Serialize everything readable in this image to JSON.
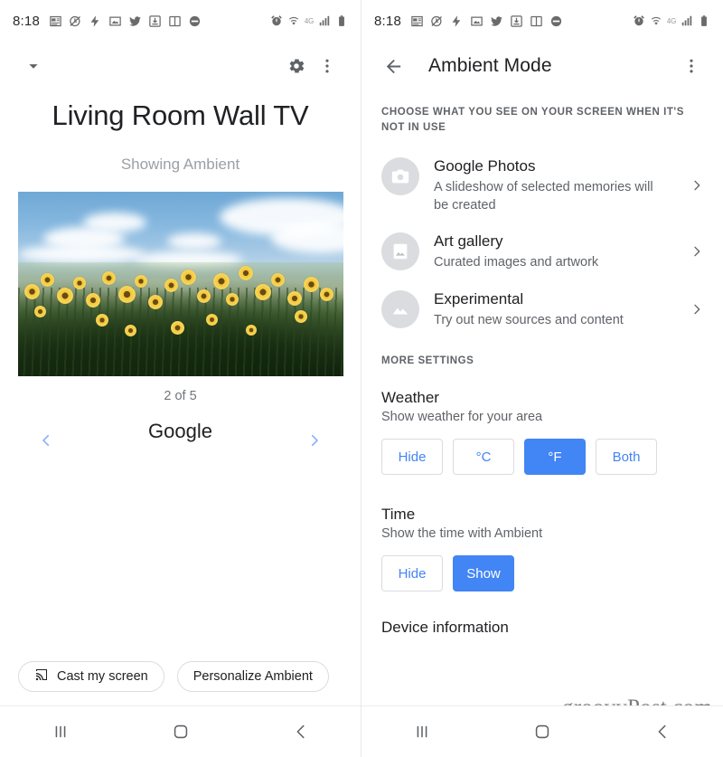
{
  "status_bar": {
    "time": "8:18",
    "left_icons": [
      "news-icon",
      "clock-alarm-off-icon",
      "flash-icon",
      "photo-icon",
      "twitter-icon",
      "download-icon",
      "book-icon",
      "no-entry-icon"
    ],
    "right_icons": [
      "alarm-icon",
      "wifi-icon",
      "signal-bars-icon",
      "battery-icon"
    ],
    "network_label": "4G"
  },
  "left_panel": {
    "top_bar": {
      "collapse_icon": "chevron-down-icon",
      "settings_icon": "gear-icon",
      "overflow_icon": "more-vert-icon"
    },
    "device_title": "Living Room Wall TV",
    "status_text": "Showing Ambient",
    "artwork_alt": "sunflower-field-photo",
    "counter": "2 of 5",
    "carousel": {
      "label": "Google",
      "prev_icon": "chevron-left-icon",
      "next_icon": "chevron-right-icon"
    },
    "chips": [
      {
        "label": "Cast my screen",
        "icon": "cast-icon"
      },
      {
        "label": "Personalize Ambient",
        "icon": ""
      }
    ]
  },
  "right_panel": {
    "top_bar": {
      "back_icon": "arrow-back-icon",
      "title": "Ambient Mode",
      "overflow_icon": "more-vert-icon"
    },
    "section_caption": "CHOOSE WHAT YOU SEE ON YOUR SCREEN WHEN IT'S NOT IN USE",
    "options": [
      {
        "icon": "camera-icon",
        "title": "Google Photos",
        "subtitle": "A slideshow of selected memories will be created",
        "chevron": "chevron-right-icon"
      },
      {
        "icon": "framed-picture-icon",
        "title": "Art gallery",
        "subtitle": "Curated images and artwork",
        "chevron": "chevron-right-icon"
      },
      {
        "icon": "landscape-icon",
        "title": "Experimental",
        "subtitle": "Try out new sources and content",
        "chevron": "chevron-right-icon"
      }
    ],
    "more_settings_caption": "MORE SETTINGS",
    "weather": {
      "title": "Weather",
      "subtitle": "Show weather for your area",
      "buttons": [
        {
          "label": "Hide",
          "selected": false
        },
        {
          "label": "°C",
          "selected": false
        },
        {
          "label": "°F",
          "selected": true
        },
        {
          "label": "Both",
          "selected": false
        }
      ]
    },
    "time": {
      "title": "Time",
      "subtitle": "Show the time with Ambient",
      "buttons": [
        {
          "label": "Hide",
          "selected": false
        },
        {
          "label": "Show",
          "selected": true
        }
      ]
    },
    "device_information": "Device information"
  },
  "nav_bar": {
    "recents_icon": "recents-icon",
    "home_icon": "home-icon",
    "back_icon": "back-icon"
  },
  "watermark": "groovyPost.com",
  "colors": {
    "accent_blue": "#4285f4",
    "link_blue": "#8ab4f8",
    "text_primary": "#202124",
    "text_secondary": "#5f6368",
    "icon_circle": "#dadce0"
  }
}
